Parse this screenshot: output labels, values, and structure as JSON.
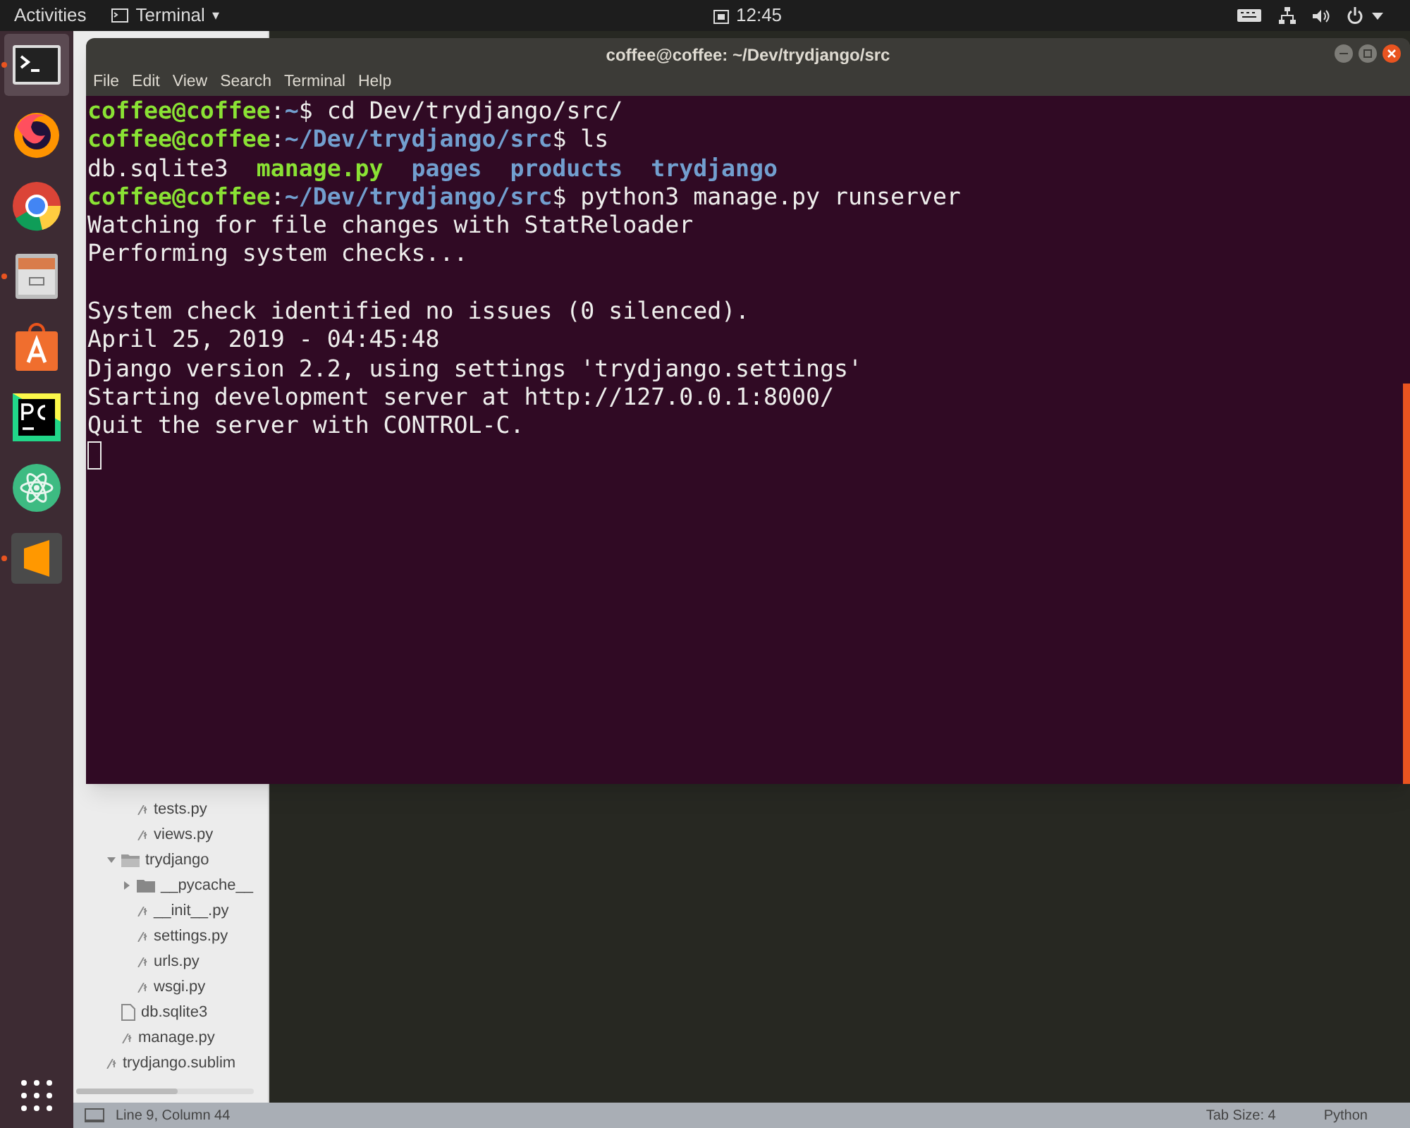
{
  "top_bar": {
    "activities": "Activities",
    "app_menu": "Terminal",
    "app_caret": "▾",
    "clock": "12:45"
  },
  "dock": [
    {
      "kind": "terminal",
      "running": true,
      "selected": true
    },
    {
      "kind": "firefox",
      "running": false,
      "selected": false
    },
    {
      "kind": "chrome",
      "running": false,
      "selected": false
    },
    {
      "kind": "files",
      "running": true,
      "selected": false
    },
    {
      "kind": "store",
      "running": false,
      "selected": false
    },
    {
      "kind": "pycharm",
      "running": false,
      "selected": false
    },
    {
      "kind": "atom",
      "running": false,
      "selected": false
    },
    {
      "kind": "sublime",
      "running": true,
      "selected": false
    }
  ],
  "editor": {
    "tree": [
      {
        "children": [
          {
            "children": [
              {
                "label": "tests.py",
                "kind": "file"
              },
              {
                "label": "views.py",
                "kind": "file"
              }
            ]
          },
          {
            "label": "trydjango",
            "kind": "folder",
            "expanded": true,
            "children": [
              {
                "label": "__pycache__",
                "kind": "folder",
                "expanded": false
              },
              {
                "label": "__init__.py",
                "kind": "file"
              },
              {
                "label": "settings.py",
                "kind": "file"
              },
              {
                "label": "urls.py",
                "kind": "file"
              },
              {
                "label": "wsgi.py",
                "kind": "file"
              }
            ]
          },
          {
            "label": "db.sqlite3",
            "kind": "doc"
          },
          {
            "label": "manage.py",
            "kind": "file"
          }
        ]
      },
      {
        "label": "trydjango.sublim",
        "kind": "file"
      }
    ],
    "status_bar": {
      "position": "Line 9, Column 44",
      "tab_size": "Tab Size: 4",
      "syntax": "Python"
    }
  },
  "terminal": {
    "title": "coffee@coffee: ~/Dev/trydjango/src",
    "menu": [
      "File",
      "Edit",
      "View",
      "Search",
      "Terminal",
      "Help"
    ],
    "lines": [
      [
        {
          "kind": "user",
          "text": "coffee@coffee"
        },
        {
          "kind": "plain",
          "text": ":"
        },
        {
          "kind": "path",
          "text": "~"
        },
        {
          "kind": "plain",
          "text": "$ cd Dev/trydjango/src/"
        }
      ],
      [
        {
          "kind": "user",
          "text": "coffee@coffee"
        },
        {
          "kind": "plain",
          "text": ":"
        },
        {
          "kind": "path",
          "text": "~/Dev/trydjango/src"
        },
        {
          "kind": "plain",
          "text": "$ ls"
        }
      ],
      [
        {
          "kind": "plain",
          "text": "db.sqlite3"
        },
        {
          "kind": "user",
          "text": "manage.py",
          "gap_before": true
        },
        {
          "kind": "path",
          "text": "pages",
          "gap_before": true
        },
        {
          "kind": "path",
          "text": "products",
          "gap_before": true
        },
        {
          "kind": "path",
          "text": "trydjango",
          "gap_before": true
        }
      ],
      [
        {
          "kind": "user",
          "text": "coffee@coffee"
        },
        {
          "kind": "plain",
          "text": ":"
        },
        {
          "kind": "path",
          "text": "~/Dev/trydjango/src"
        },
        {
          "kind": "plain",
          "text": "$ python3 manage.py runserver"
        }
      ],
      [
        {
          "kind": "plain",
          "text": "Watching for file changes with StatReloader"
        }
      ],
      [
        {
          "kind": "plain",
          "text": "Performing system checks..."
        }
      ],
      [
        {
          "kind": "blank"
        }
      ],
      [
        {
          "kind": "plain",
          "text": "System check identified no issues (0 silenced)."
        }
      ],
      [
        {
          "kind": "plain",
          "text": "April 25, 2019 - 04:45:48"
        }
      ],
      [
        {
          "kind": "plain",
          "text": "Django version 2.2, using settings 'trydjango.settings'"
        }
      ],
      [
        {
          "kind": "plain",
          "text": "Starting development server at http://127.0.0.1:8000/"
        }
      ],
      [
        {
          "kind": "plain",
          "text": "Quit the server with CONTROL-C."
        }
      ]
    ]
  }
}
